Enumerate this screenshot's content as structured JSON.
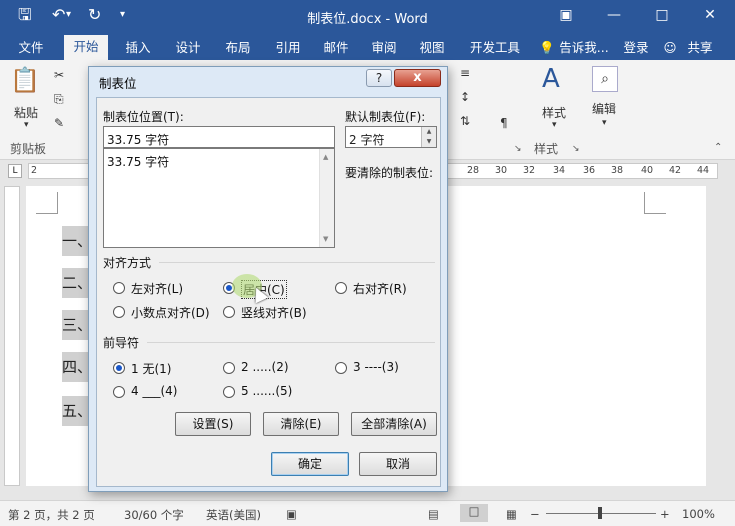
{
  "title_bar": {
    "doc_title": "制表位.docx - Word",
    "qa_icons": [
      "save-icon",
      "undo-icon",
      "redo-icon",
      "customize-qa-icon"
    ],
    "window_icons": [
      "ribbon-display-icon",
      "minimize-icon",
      "maximize-icon",
      "close-icon"
    ]
  },
  "menu": {
    "tabs": [
      "文件",
      "开始",
      "插入",
      "设计",
      "布局",
      "引用",
      "邮件",
      "审阅",
      "视图",
      "开发工具"
    ],
    "active_tab": "开始",
    "tell_me": "告诉我...",
    "login": "登录",
    "share": "共享"
  },
  "ribbon": {
    "paste": "粘贴",
    "clipboard": "剪贴板",
    "styles": "样式",
    "styles_group": "样式",
    "edit": "编辑"
  },
  "ruler": {
    "left_numbers": [
      "2"
    ],
    "right_numbers": [
      "28",
      "30",
      "32",
      "34",
      "36",
      "38",
      "40",
      "42",
      "44"
    ]
  },
  "document": {
    "headings": [
      "一、",
      "二、",
      "三、",
      "四、",
      "五、"
    ]
  },
  "dialog": {
    "title": "制表位",
    "help": "?",
    "close": "x",
    "tab_stop_position_label": "制表位位置(T):",
    "tab_stop_position_value": "33.75 字符",
    "tab_stop_list": [
      "33.75 字符"
    ],
    "default_tab_label": "默认制表位(F):",
    "default_tab_value": "2 字符",
    "clear_label": "要清除的制表位:",
    "alignment_label": "对齐方式",
    "alignment_options": [
      {
        "label": "左对齐(L)",
        "checked": false
      },
      {
        "label": "居中(C)",
        "checked": true
      },
      {
        "label": "右对齐(R)",
        "checked": false
      },
      {
        "label": "小数点对齐(D)",
        "checked": false
      },
      {
        "label": "竖线对齐(B)",
        "checked": false
      }
    ],
    "leader_label": "前导符",
    "leader_options": [
      {
        "label": "1 无(1)",
        "checked": true
      },
      {
        "label": "2 .....(2)",
        "checked": false
      },
      {
        "label": "3 ----(3)",
        "checked": false
      },
      {
        "label": "4 ___(4)",
        "checked": false
      },
      {
        "label": "5 ......(5)",
        "checked": false
      }
    ],
    "buttons": {
      "set": "设置(S)",
      "clear": "清除(E)",
      "clear_all": "全部清除(A)",
      "ok": "确定",
      "cancel": "取消"
    }
  },
  "status_bar": {
    "page": "第 2 页，共 2 页",
    "words": "30/60 个字",
    "language": "英语(美国)",
    "zoom": "100%"
  },
  "colors": {
    "titlebar": "#2b579a",
    "dialog_frame": "#dde9f6",
    "dialog_body": "#f0f0f0",
    "close_button": "#c4422b"
  }
}
